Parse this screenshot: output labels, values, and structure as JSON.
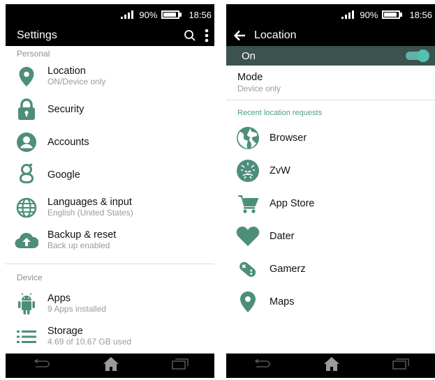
{
  "colors": {
    "accent": "#4a9d88",
    "icon": "#4d8e7b",
    "toggle_bar": "#3b524f",
    "switch": "#4fc3b0"
  },
  "left": {
    "status": {
      "battery": "90%",
      "time": "18:56",
      "battery_level": 0.9
    },
    "appbar": {
      "title": "Settings"
    },
    "personal_label": "Personal",
    "personal_items": [
      {
        "icon": "location-pin-icon",
        "title": "Location",
        "subtitle": "ON/Device only"
      },
      {
        "icon": "lock-icon",
        "title": "Security",
        "subtitle": ""
      },
      {
        "icon": "account-circle-icon",
        "title": "Accounts",
        "subtitle": ""
      },
      {
        "icon": "google-icon",
        "title": "Google",
        "subtitle": ""
      },
      {
        "icon": "globe-icon",
        "title": "Languages & input",
        "subtitle": "English (United States)"
      },
      {
        "icon": "cloud-upload-icon",
        "title": "Backup & reset",
        "subtitle": "Back up enabled"
      }
    ],
    "device_label": "Device",
    "device_items": [
      {
        "icon": "android-icon",
        "title": "Apps",
        "subtitle": "9 Apps installed"
      },
      {
        "icon": "storage-list-icon",
        "title": "Storage",
        "subtitle": "4.69 of 10.67 GB used"
      }
    ]
  },
  "right": {
    "status": {
      "battery": "90%",
      "time": "18:56",
      "battery_level": 0.9
    },
    "appbar": {
      "title": "Location"
    },
    "toggle": {
      "label": "On",
      "state": true
    },
    "mode": {
      "title": "Mode",
      "value": "Device only"
    },
    "recent_label": "Recent location requests",
    "apps": [
      {
        "icon": "browser-globe-icon",
        "name": "Browser"
      },
      {
        "icon": "zvw-icon",
        "name": "ZvW"
      },
      {
        "icon": "cart-icon",
        "name": "App Store"
      },
      {
        "icon": "heart-icon",
        "name": "Dater"
      },
      {
        "icon": "gamepad-icon",
        "name": "Gamerz"
      },
      {
        "icon": "maps-pin-icon",
        "name": "Maps"
      }
    ]
  }
}
